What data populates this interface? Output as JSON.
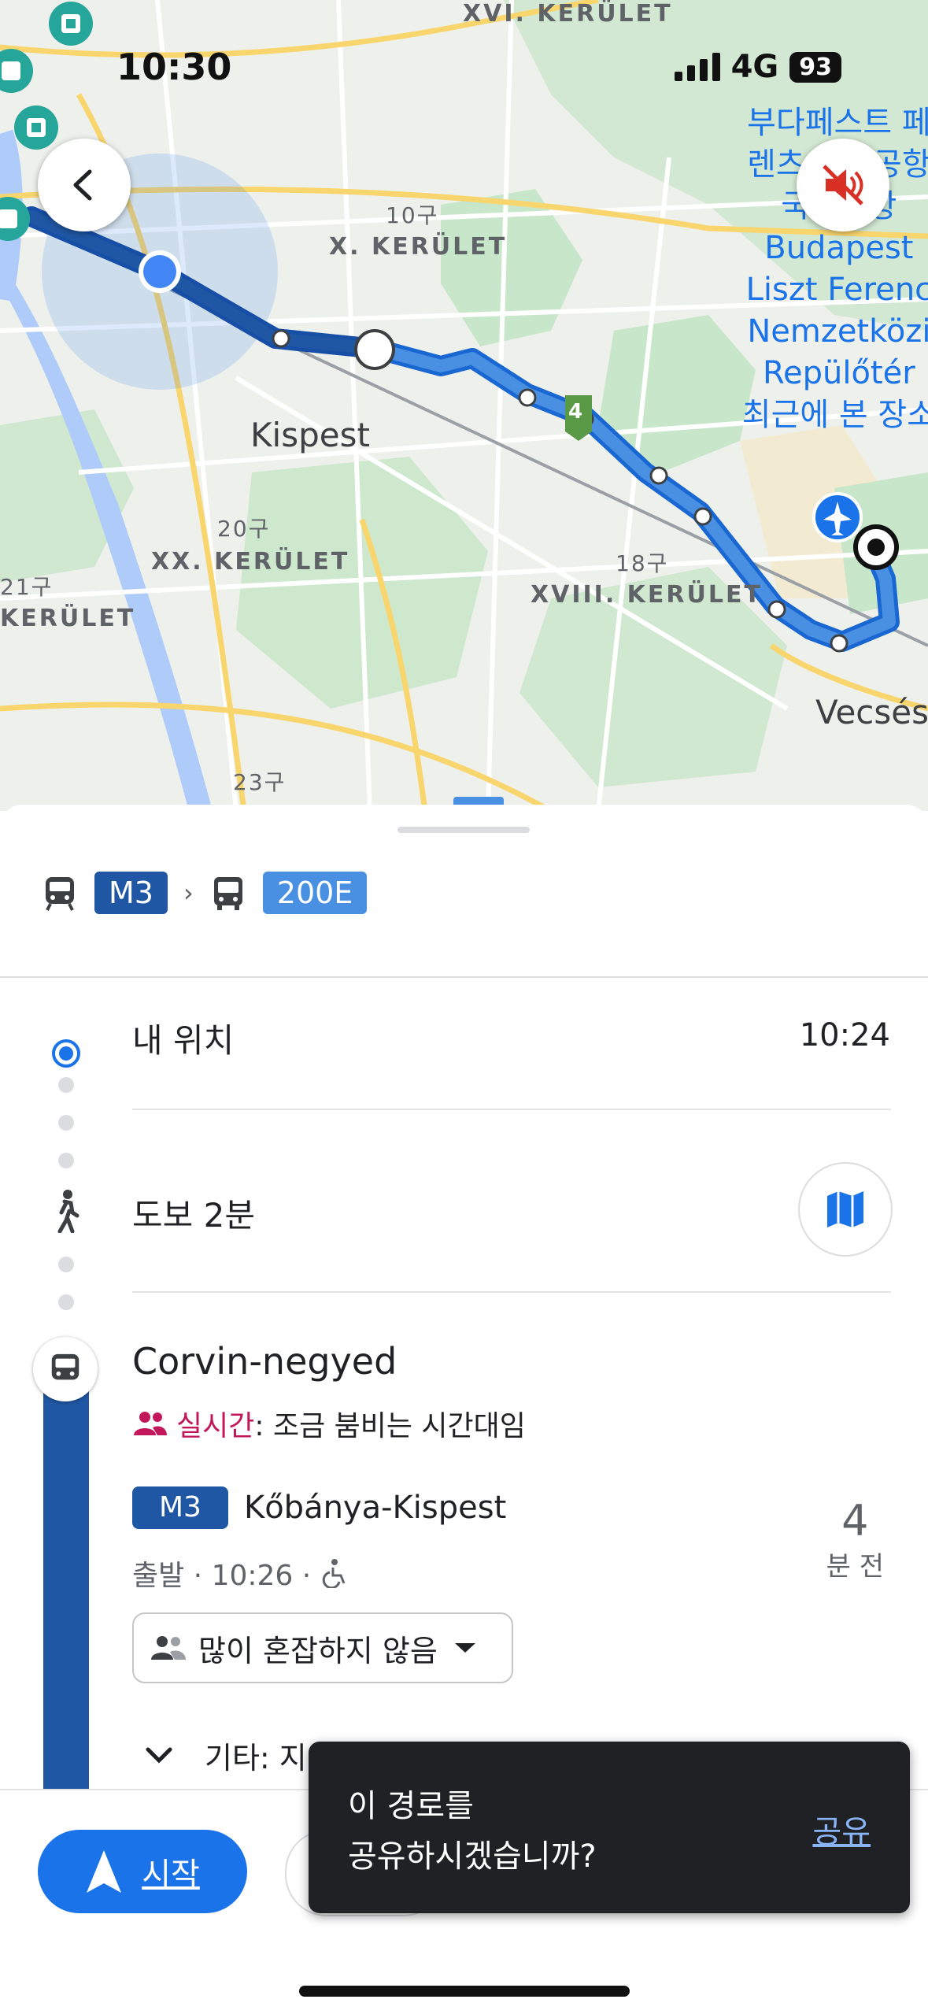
{
  "status_bar": {
    "time": "10:30",
    "network": "4G",
    "battery": "93"
  },
  "map": {
    "labels": {
      "district_16": "XVI. KERÜLET",
      "district_10_ko": "10구",
      "district_10": "X. KERÜLET",
      "kispest": "Kispest",
      "district_20_ko": "20구",
      "district_20": "XX. KERÜLET",
      "district_18_ko": "18구",
      "district_18": "XVIII. KERÜLET",
      "district_21_ko": "21구",
      "district_21": "KERÜLET",
      "district_23_ko": "23구",
      "vecses": "Vecsés",
      "stop_badge": "4"
    },
    "airport": {
      "ko_line1": "부다페스트 페",
      "ko_line2": "렌츠 국제공항",
      "ko_line3": "국제공항",
      "line1": "Budapest",
      "line2": "Liszt Ferenc",
      "line3": "Nemzetközi",
      "line4": "Repülőtér",
      "recent": "최근에 본 장소"
    },
    "route_color": "#1a73e8"
  },
  "sheet": {
    "summary": {
      "line1": "M3",
      "line2": "200E"
    },
    "origin": {
      "label": "내 위치",
      "time": "10:24"
    },
    "walk": {
      "label": "도보 2분"
    },
    "stop": {
      "name": "Corvin-negyed",
      "realtime_prefix": "실시간",
      "realtime_text": ": 조금 붐비는 시간대임",
      "line": "M3",
      "direction": "Kőbánya-Kispest",
      "depart": "출발 · 10:26 ·",
      "minutes": "4",
      "minutes_label": "분 전",
      "crowd": "많이 혼잡하지 않음",
      "other": "기타: 지"
    }
  },
  "bottom": {
    "start": "시작"
  },
  "toast": {
    "line1": "이 경로를",
    "line2": "공유하시겠습니까?",
    "action": "공유"
  }
}
